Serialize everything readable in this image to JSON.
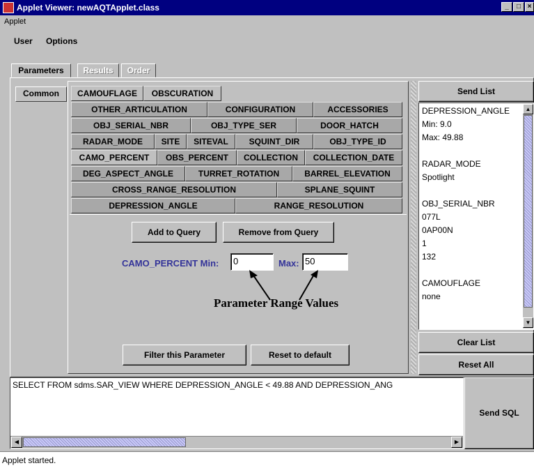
{
  "window": {
    "title": "Applet Viewer: newAQTApplet.class"
  },
  "menu1": {
    "applet": "Applet"
  },
  "menu2": {
    "user": "User",
    "options": "Options"
  },
  "main_tabs": [
    "Parameters",
    "Results",
    "Order"
  ],
  "side_tab": "Common",
  "param_tab_rows": [
    [
      "CAMOUFLAGE",
      "OBSCURATION"
    ],
    [
      "OTHER_ARTICULATION",
      "CONFIGURATION",
      "ACCESSORIES"
    ],
    [
      "OBJ_SERIAL_NBR",
      "OBJ_TYPE_SER",
      "DOOR_HATCH"
    ],
    [
      "RADAR_MODE",
      "SITE",
      "SITEVAL",
      "SQUINT_DIR",
      "OBJ_TYPE_ID"
    ],
    [
      "CAMO_PERCENT",
      "OBS_PERCENT",
      "COLLECTION",
      "COLLECTION_DATE"
    ],
    [
      "DEG_ASPECT_ANGLE",
      "TURRET_ROTATION",
      "BARREL_ELEVATION"
    ],
    [
      "CROSS_RANGE_RESOLUTION",
      "SPLANE_SQUINT"
    ],
    [
      "DEPRESSION_ANGLE",
      "RANGE_RESOLUTION"
    ]
  ],
  "buttons": {
    "add_to_query": "Add to Query",
    "remove_from_query": "Remove from Query",
    "filter": "Filter this Parameter",
    "reset_default": "Reset to default",
    "send_list": "Send List",
    "clear_list": "Clear List",
    "reset_all": "Reset All",
    "send_sql": "Send SQL"
  },
  "range": {
    "label": "CAMO_PERCENT Min:",
    "min_value": "0",
    "max_label": "Max:",
    "max_value": "50",
    "annotation": "Parameter Range Values"
  },
  "list_lines": [
    "DEPRESSION_ANGLE",
    " Min: 9.0",
    " Max: 49.88",
    "",
    "RADAR_MODE",
    " Spotlight",
    "",
    "OBJ_SERIAL_NBR",
    " 077L",
    " 0AP00N",
    " 1",
    " 132",
    "",
    "CAMOUFLAGE",
    " none"
  ],
  "sql_text": "SELECT  FROM sdms.SAR_VIEW WHERE DEPRESSION_ANGLE < 49.88 AND DEPRESSION_ANG",
  "status": "Applet started.",
  "colors": {
    "title_bg": "#000080",
    "panel": "#c0c0c0",
    "range_label": "#333399"
  }
}
